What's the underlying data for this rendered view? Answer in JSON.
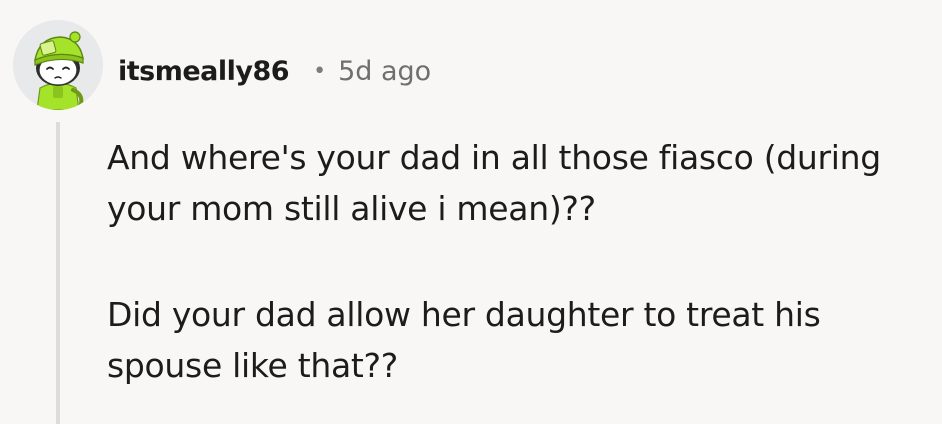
{
  "comment": {
    "username": "itsmeally86",
    "separator": "•",
    "timestamp": "5d ago",
    "paragraphs": [
      "And where's your dad in all those fiasco (during your mom still alive i mean)??",
      "Did your dad allow her daughter to treat his spouse like that??"
    ]
  },
  "avatar": {
    "icon": "snoo-avatar-icon",
    "background": "#e7e9eb",
    "outfit_color": "#a5e22a"
  },
  "colors": {
    "page_background": "#f8f7f6",
    "text": "#1c1c1c",
    "meta_text": "#6f6f6f",
    "thread_line": "#dcdcdc"
  }
}
